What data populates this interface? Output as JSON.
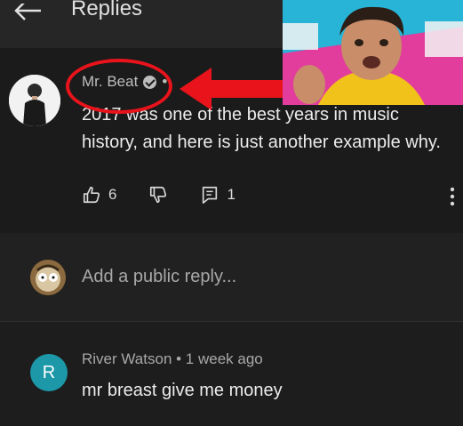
{
  "header": {
    "title": "Replies"
  },
  "comment": {
    "author": "Mr. Beat",
    "separator": "•",
    "text_line1": "2017 was one of the best years in music",
    "text_line2": "history, and here is just another example why.",
    "likes": "6",
    "replies_count": "1"
  },
  "reply_box": {
    "placeholder": "Add a public reply..."
  },
  "reply": {
    "avatar_letter": "R",
    "meta": "River Watson • 1 week ago",
    "text": "mr breast give me  money"
  },
  "icons": {
    "back": "back-arrow-icon",
    "verified": "verified-check-icon",
    "like": "thumbs-up-icon",
    "dislike": "thumbs-down-icon",
    "reply": "reply-comment-icon",
    "more": "more-vertical-icon"
  },
  "colors": {
    "background": "#1e1e1e",
    "annotation_red": "#e8131b",
    "reply_avatar": "#1d98a8"
  }
}
